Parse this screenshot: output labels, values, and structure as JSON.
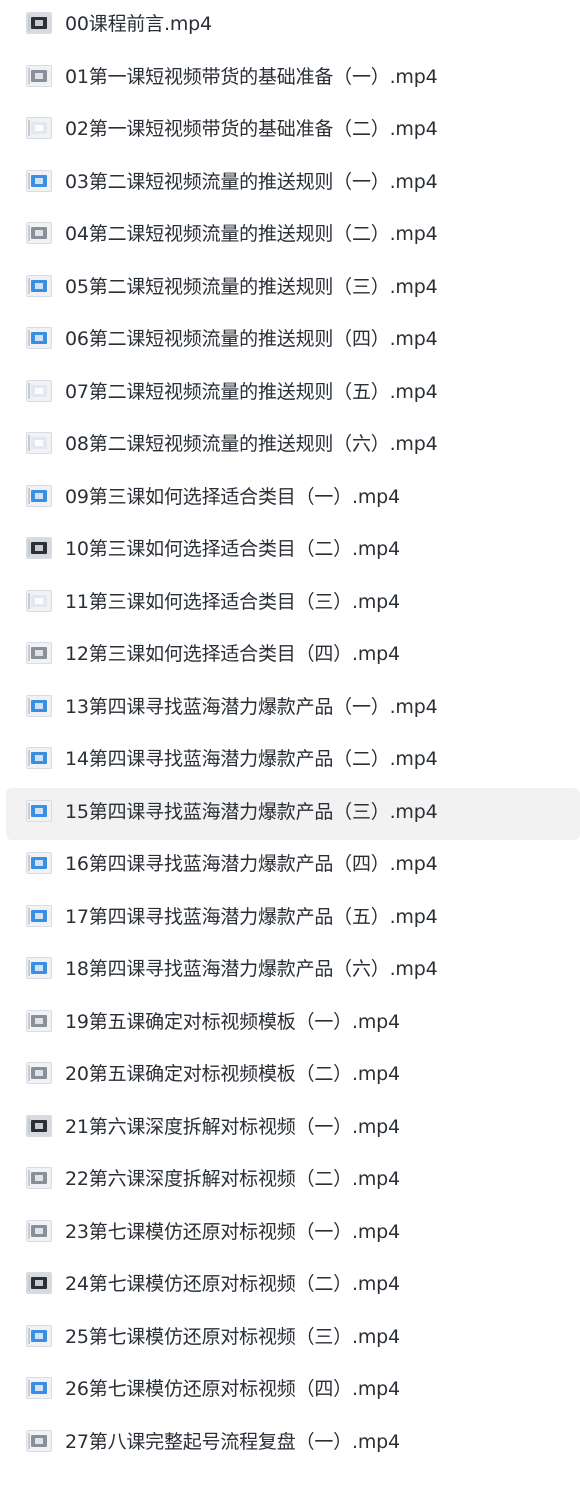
{
  "files": [
    {
      "name": "00课程前言.mp4",
      "icon": "video-thumbnail-icon",
      "thumb": "dark"
    },
    {
      "name": "01第一课短视频带货的基础准备（一）.mp4",
      "icon": "video-thumbnail-icon",
      "thumb": "gray"
    },
    {
      "name": "02第一课短视频带货的基础准备（二）.mp4",
      "icon": "video-thumbnail-icon",
      "thumb": "light"
    },
    {
      "name": "03第二课短视频流量的推送规则（一）.mp4",
      "icon": "video-thumbnail-icon",
      "thumb": "blue"
    },
    {
      "name": "04第二课短视频流量的推送规则（二）.mp4",
      "icon": "video-thumbnail-icon",
      "thumb": "gray"
    },
    {
      "name": "05第二课短视频流量的推送规则（三）.mp4",
      "icon": "video-thumbnail-icon",
      "thumb": "blue"
    },
    {
      "name": "06第二课短视频流量的推送规则（四）.mp4",
      "icon": "video-thumbnail-icon",
      "thumb": "blue"
    },
    {
      "name": "07第二课短视频流量的推送规则（五）.mp4",
      "icon": "video-thumbnail-icon",
      "thumb": "light"
    },
    {
      "name": "08第二课短视频流量的推送规则（六）.mp4",
      "icon": "video-thumbnail-icon",
      "thumb": "light"
    },
    {
      "name": "09第三课如何选择适合类目（一）.mp4",
      "icon": "video-thumbnail-icon",
      "thumb": "blue"
    },
    {
      "name": "10第三课如何选择适合类目（二）.mp4",
      "icon": "video-thumbnail-icon",
      "thumb": "dark"
    },
    {
      "name": "11第三课如何选择适合类目（三）.mp4",
      "icon": "video-thumbnail-icon",
      "thumb": "light"
    },
    {
      "name": "12第三课如何选择适合类目（四）.mp4",
      "icon": "video-thumbnail-icon",
      "thumb": "gray"
    },
    {
      "name": "13第四课寻找蓝海潜力爆款产品（一）.mp4",
      "icon": "video-thumbnail-icon",
      "thumb": "blue"
    },
    {
      "name": "14第四课寻找蓝海潜力爆款产品（二）.mp4",
      "icon": "video-thumbnail-icon",
      "thumb": "blue"
    },
    {
      "name": "15第四课寻找蓝海潜力爆款产品（三）.mp4",
      "icon": "video-thumbnail-icon",
      "thumb": "blue",
      "hovered": true
    },
    {
      "name": "16第四课寻找蓝海潜力爆款产品（四）.mp4",
      "icon": "video-thumbnail-icon",
      "thumb": "blue"
    },
    {
      "name": "17第四课寻找蓝海潜力爆款产品（五）.mp4",
      "icon": "video-thumbnail-icon",
      "thumb": "blue"
    },
    {
      "name": "18第四课寻找蓝海潜力爆款产品（六）.mp4",
      "icon": "video-thumbnail-icon",
      "thumb": "blue"
    },
    {
      "name": "19第五课确定对标视频模板（一）.mp4",
      "icon": "video-thumbnail-icon",
      "thumb": "gray"
    },
    {
      "name": "20第五课确定对标视频模板（二）.mp4",
      "icon": "video-thumbnail-icon",
      "thumb": "gray"
    },
    {
      "name": "21第六课深度拆解对标视频（一）.mp4",
      "icon": "video-thumbnail-icon",
      "thumb": "dark"
    },
    {
      "name": "22第六课深度拆解对标视频（二）.mp4",
      "icon": "video-thumbnail-icon",
      "thumb": "gray"
    },
    {
      "name": "23第七课模仿还原对标视频（一）.mp4",
      "icon": "video-thumbnail-icon",
      "thumb": "gray"
    },
    {
      "name": "24第七课模仿还原对标视频（二）.mp4",
      "icon": "video-thumbnail-icon",
      "thumb": "dark"
    },
    {
      "name": "25第七课模仿还原对标视频（三）.mp4",
      "icon": "video-thumbnail-icon",
      "thumb": "blue"
    },
    {
      "name": "26第七课模仿还原对标视频（四）.mp4",
      "icon": "video-thumbnail-icon",
      "thumb": "blue"
    },
    {
      "name": "27第八课完整起号流程复盘（一）.mp4",
      "icon": "video-thumbnail-icon",
      "thumb": "gray"
    }
  ],
  "colors": {
    "text": "#2a2f36",
    "hover_bg": "#f2f2f3",
    "thumb_border": "#d9dde3",
    "thumb_blue": "#3c8fe0",
    "thumb_dark": "#2b2f36",
    "thumb_gray": "#8a9099",
    "thumb_light": "#e4e8ee"
  }
}
